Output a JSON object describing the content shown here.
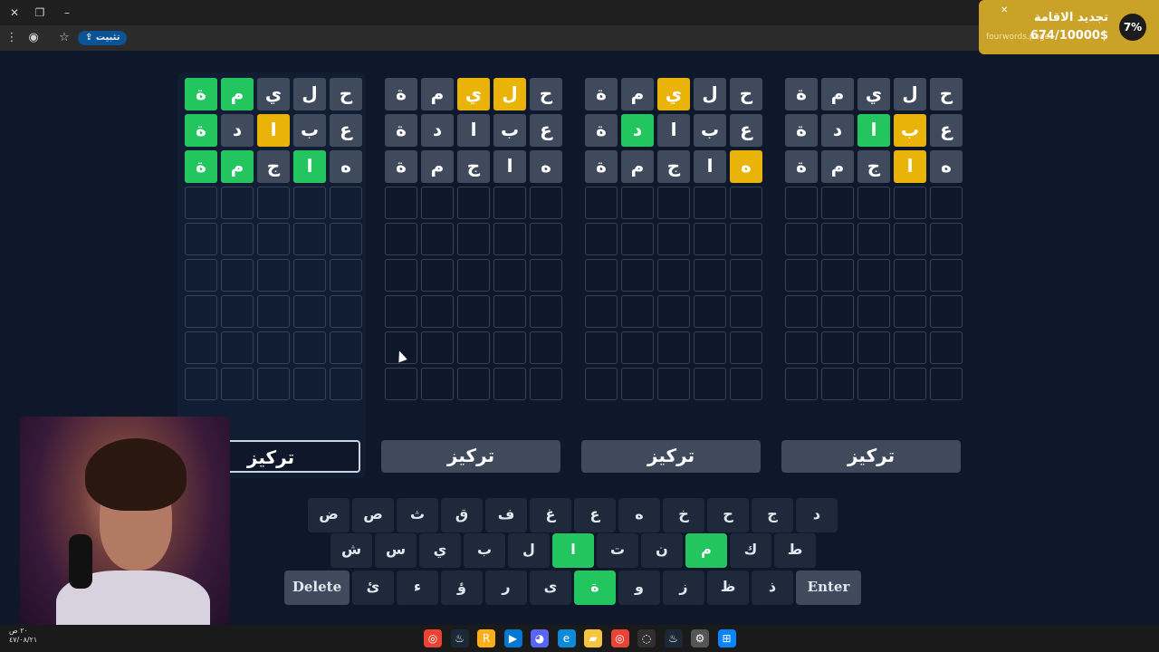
{
  "browser": {
    "install_label": "تثبيت"
  },
  "donation": {
    "title": "تجديد الاقامة",
    "url": "fourwords.page",
    "amount": "674/10000$",
    "percent": "7%"
  },
  "boards": [
    {
      "rows": [
        [
          {
            "l": "ح",
            "s": "gray"
          },
          {
            "l": "ل",
            "s": "gray"
          },
          {
            "l": "ي",
            "s": "gray"
          },
          {
            "l": "م",
            "s": "green"
          },
          {
            "l": "ة",
            "s": "green"
          }
        ],
        [
          {
            "l": "ع",
            "s": "gray"
          },
          {
            "l": "ب",
            "s": "gray"
          },
          {
            "l": "ا",
            "s": "yellow"
          },
          {
            "l": "د",
            "s": "gray"
          },
          {
            "l": "ة",
            "s": "green"
          }
        ],
        [
          {
            "l": "ه",
            "s": "gray"
          },
          {
            "l": "ا",
            "s": "green"
          },
          {
            "l": "ج",
            "s": "gray"
          },
          {
            "l": "م",
            "s": "green"
          },
          {
            "l": "ة",
            "s": "green"
          }
        ]
      ],
      "focus_label": "تركيز",
      "active": true
    },
    {
      "rows": [
        [
          {
            "l": "ح",
            "s": "gray"
          },
          {
            "l": "ل",
            "s": "yellow"
          },
          {
            "l": "ي",
            "s": "yellow"
          },
          {
            "l": "م",
            "s": "gray"
          },
          {
            "l": "ة",
            "s": "gray"
          }
        ],
        [
          {
            "l": "ع",
            "s": "gray"
          },
          {
            "l": "ب",
            "s": "gray"
          },
          {
            "l": "ا",
            "s": "gray"
          },
          {
            "l": "د",
            "s": "gray"
          },
          {
            "l": "ة",
            "s": "gray"
          }
        ],
        [
          {
            "l": "ه",
            "s": "gray"
          },
          {
            "l": "ا",
            "s": "gray"
          },
          {
            "l": "ج",
            "s": "gray"
          },
          {
            "l": "م",
            "s": "gray"
          },
          {
            "l": "ة",
            "s": "gray"
          }
        ]
      ],
      "focus_label": "تركيز",
      "active": false
    },
    {
      "rows": [
        [
          {
            "l": "ح",
            "s": "gray"
          },
          {
            "l": "ل",
            "s": "gray"
          },
          {
            "l": "ي",
            "s": "yellow"
          },
          {
            "l": "م",
            "s": "gray"
          },
          {
            "l": "ة",
            "s": "gray"
          }
        ],
        [
          {
            "l": "ع",
            "s": "gray"
          },
          {
            "l": "ب",
            "s": "gray"
          },
          {
            "l": "ا",
            "s": "gray"
          },
          {
            "l": "د",
            "s": "green"
          },
          {
            "l": "ة",
            "s": "gray"
          }
        ],
        [
          {
            "l": "ه",
            "s": "yellow"
          },
          {
            "l": "ا",
            "s": "gray"
          },
          {
            "l": "ج",
            "s": "gray"
          },
          {
            "l": "م",
            "s": "gray"
          },
          {
            "l": "ة",
            "s": "gray"
          }
        ]
      ],
      "focus_label": "تركيز",
      "active": false
    },
    {
      "rows": [
        [
          {
            "l": "ح",
            "s": "gray"
          },
          {
            "l": "ل",
            "s": "gray"
          },
          {
            "l": "ي",
            "s": "gray"
          },
          {
            "l": "م",
            "s": "gray"
          },
          {
            "l": "ة",
            "s": "gray"
          }
        ],
        [
          {
            "l": "ع",
            "s": "gray"
          },
          {
            "l": "ب",
            "s": "yellow"
          },
          {
            "l": "ا",
            "s": "green"
          },
          {
            "l": "د",
            "s": "gray"
          },
          {
            "l": "ة",
            "s": "gray"
          }
        ],
        [
          {
            "l": "ه",
            "s": "gray"
          },
          {
            "l": "ا",
            "s": "yellow"
          },
          {
            "l": "ج",
            "s": "gray"
          },
          {
            "l": "م",
            "s": "gray"
          },
          {
            "l": "ة",
            "s": "gray"
          }
        ]
      ],
      "focus_label": "تركيز",
      "active": false
    }
  ],
  "keyboard": {
    "row1": [
      {
        "l": "ض"
      },
      {
        "l": "ص"
      },
      {
        "l": "ث"
      },
      {
        "l": "ق"
      },
      {
        "l": "ف"
      },
      {
        "l": "غ"
      },
      {
        "l": "ع"
      },
      {
        "l": "ه"
      },
      {
        "l": "خ"
      },
      {
        "l": "ح"
      },
      {
        "l": "ج"
      },
      {
        "l": "د"
      }
    ],
    "row2": [
      {
        "l": "ش"
      },
      {
        "l": "س"
      },
      {
        "l": "ي"
      },
      {
        "l": "ب"
      },
      {
        "l": "ل"
      },
      {
        "l": "ا",
        "s": "green"
      },
      {
        "l": "ت"
      },
      {
        "l": "ن"
      },
      {
        "l": "م",
        "s": "green"
      },
      {
        "l": "ك"
      },
      {
        "l": "ط"
      }
    ],
    "row3": [
      {
        "l": "Delete",
        "wide": true
      },
      {
        "l": "ئ"
      },
      {
        "l": "ء"
      },
      {
        "l": "ؤ"
      },
      {
        "l": "ر"
      },
      {
        "l": "ى"
      },
      {
        "l": "ة",
        "s": "green"
      },
      {
        "l": "و"
      },
      {
        "l": "ز"
      },
      {
        "l": "ظ"
      },
      {
        "l": "ذ"
      },
      {
        "l": "Enter",
        "wide": true
      }
    ]
  },
  "clock": {
    "time": "٢٠ ص",
    "date": "٤٧/٠٨/٢١"
  },
  "taskbar_icons": [
    "chrome-icon",
    "steam-icon",
    "rockstar-icon",
    "remote-icon",
    "discord-icon",
    "edge-icon",
    "folder-icon",
    "chrome-icon",
    "obs-icon",
    "steam-icon",
    "settings-icon",
    "windows-icon"
  ]
}
